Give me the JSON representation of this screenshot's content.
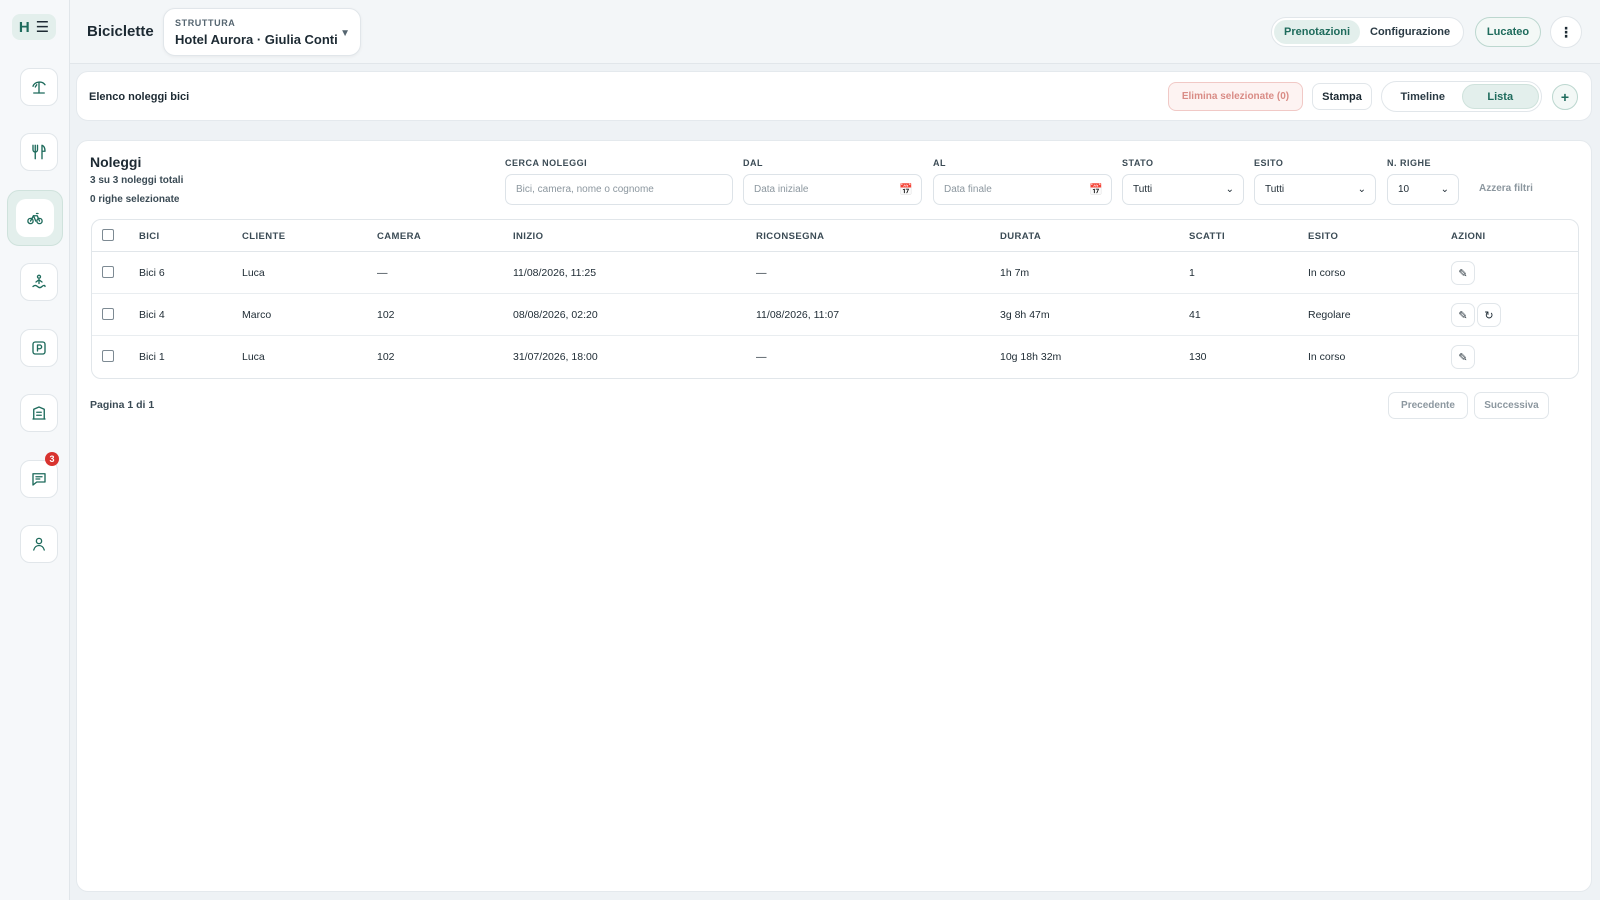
{
  "app": {
    "logo_letter": "H"
  },
  "header": {
    "title": "Biciclette",
    "structure": {
      "label": "STRUTTURA",
      "value": "Hotel Aurora · Giulia Conti"
    },
    "tabs": [
      {
        "label": "Prenotazioni",
        "active": true
      },
      {
        "label": "Configurazione",
        "active": false
      }
    ],
    "user": "Lucateo"
  },
  "sidebar": {
    "items": [
      {
        "name": "beach",
        "icon": "umbrella-icon"
      },
      {
        "name": "restaurant",
        "icon": "utensils-icon"
      },
      {
        "name": "bikes",
        "icon": "bike-icon",
        "active": true
      },
      {
        "name": "pool",
        "icon": "swimmer-icon"
      },
      {
        "name": "parking",
        "icon": "parking-icon"
      },
      {
        "name": "spa",
        "icon": "building-icon"
      },
      {
        "name": "messages",
        "icon": "chat-icon",
        "badge": "3"
      },
      {
        "name": "profile",
        "icon": "user-icon"
      }
    ]
  },
  "toolbar": {
    "title": "Elenco noleggi bici",
    "delete_label": "Elimina selezionate (0)",
    "print_label": "Stampa",
    "views": [
      {
        "label": "Timeline",
        "active": false
      },
      {
        "label": "Lista",
        "active": true
      }
    ],
    "add_label": "+"
  },
  "section": {
    "title": "Noleggi",
    "summary": "3 su 3 noleggi totali",
    "selected": "0 righe selezionate"
  },
  "filters": {
    "search": {
      "label": "CERCA NOLEGGI",
      "placeholder": "Bici, camera, nome o cognome"
    },
    "from": {
      "label": "DAL",
      "placeholder": "Data iniziale"
    },
    "to": {
      "label": "AL",
      "placeholder": "Data finale"
    },
    "status": {
      "label": "STATO",
      "value": "Tutti"
    },
    "outcome": {
      "label": "ESITO",
      "value": "Tutti"
    },
    "rows": {
      "label": "N. RIGHE",
      "value": "10"
    },
    "reset_label": "Azzera filtri"
  },
  "table": {
    "columns": [
      "BICI",
      "CLIENTE",
      "CAMERA",
      "INIZIO",
      "RICONSEGNA",
      "DURATA",
      "SCATTI",
      "ESITO",
      "AZIONI"
    ],
    "rows": [
      {
        "bike": "Bici 6",
        "client": "Luca",
        "room": "—",
        "start": "11/08/2026, 11:25",
        "return": "—",
        "duration": "1h 7m",
        "shots": "1",
        "outcome": "In corso",
        "actions": [
          "edit"
        ]
      },
      {
        "bike": "Bici 4",
        "client": "Marco",
        "room": "102",
        "start": "08/08/2026, 02:20",
        "return": "11/08/2026, 11:07",
        "duration": "3g 8h 47m",
        "shots": "41",
        "outcome": "Regolare",
        "actions": [
          "edit",
          "restore"
        ]
      },
      {
        "bike": "Bici 1",
        "client": "Luca",
        "room": "102",
        "start": "31/07/2026, 18:00",
        "return": "—",
        "duration": "10g 18h 32m",
        "shots": "130",
        "outcome": "In corso",
        "actions": [
          "edit"
        ]
      }
    ]
  },
  "pager": {
    "text": "Pagina 1 di 1",
    "prev": "Precedente",
    "next": "Successiva"
  },
  "colors": {
    "accent": "#1e6b5c",
    "accent_bg": "#e3efec",
    "danger": "#d8332f"
  }
}
